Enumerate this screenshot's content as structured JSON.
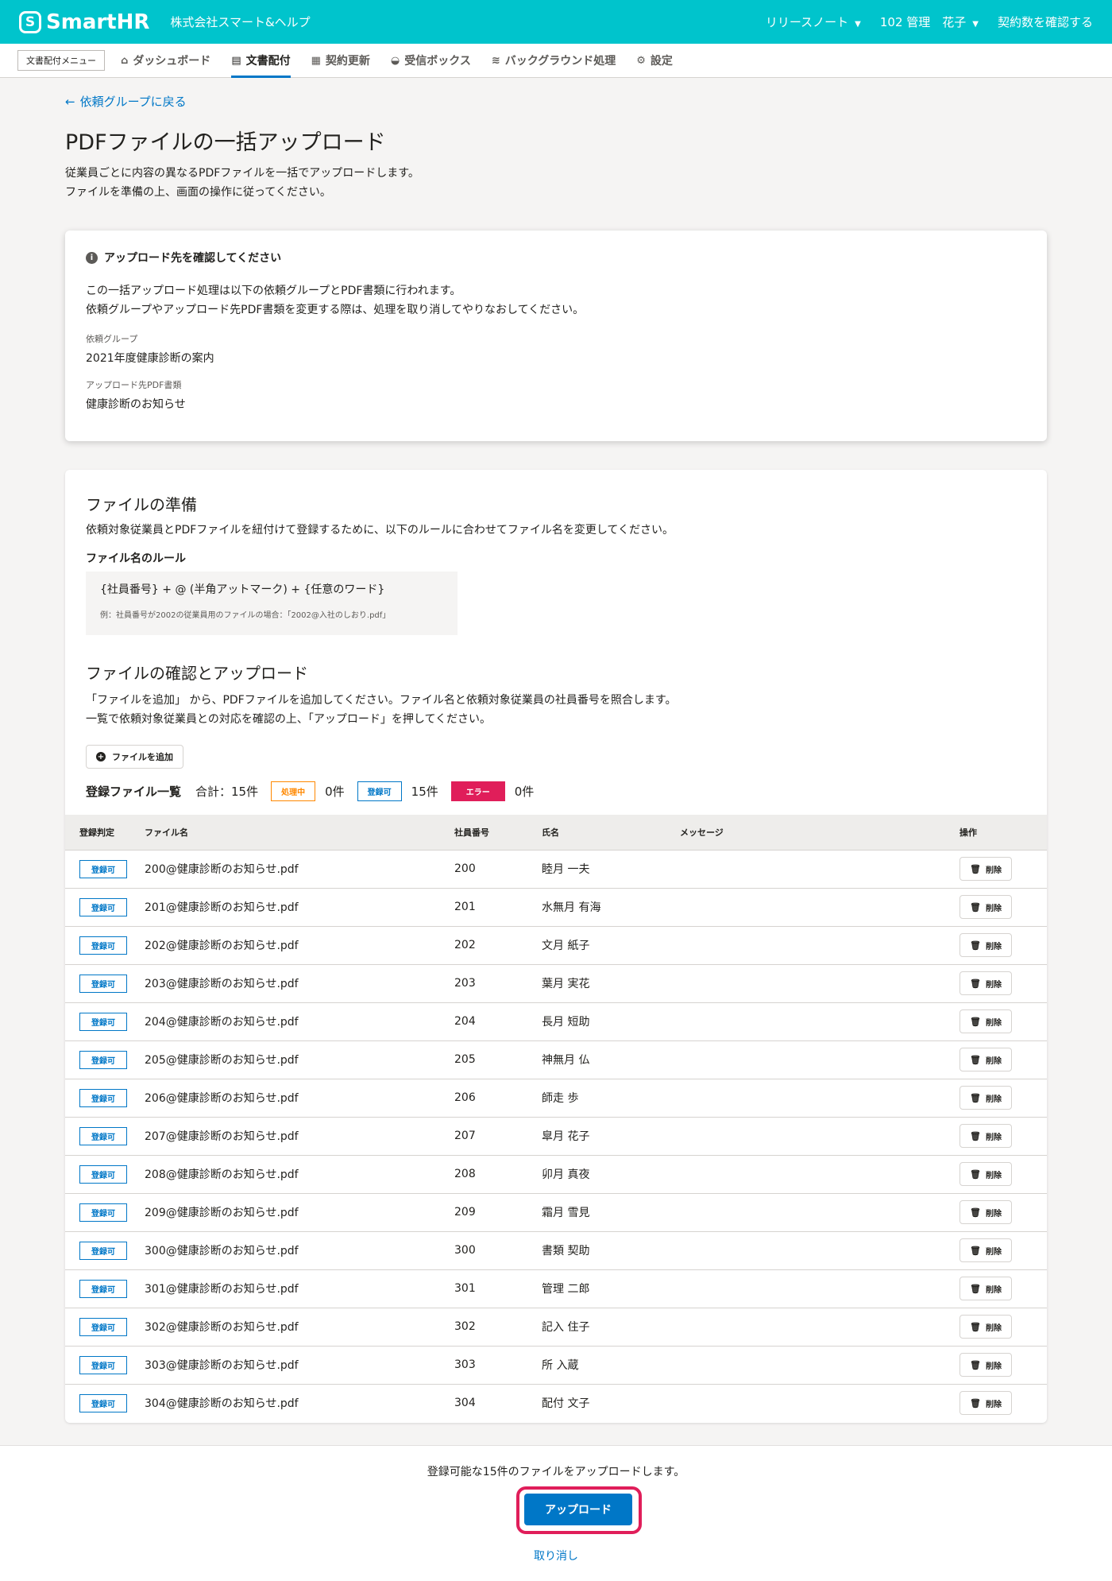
{
  "header": {
    "logo_mark": "S",
    "logo_text": "SmartHR",
    "company": "株式会社スマート&ヘルプ",
    "release_notes": "リリースノート",
    "user": "102 管理　花子",
    "contract_link": "契約数を確認する"
  },
  "nav": {
    "menu_chip": "文書配付メニュー",
    "items": [
      {
        "label": "ダッシュボード",
        "icon": "⌂"
      },
      {
        "label": "文書配付",
        "icon": "▤"
      },
      {
        "label": "契約更新",
        "icon": "▦"
      },
      {
        "label": "受信ボックス",
        "icon": "◒"
      },
      {
        "label": "バックグラウンド処理",
        "icon": "≋"
      },
      {
        "label": "設定",
        "icon": "⚙"
      }
    ]
  },
  "page": {
    "back_link": "依頼グループに戻る",
    "title": "PDFファイルの一括アップロード",
    "desc_line1": "従業員ごとに内容の異なるPDFファイルを一括でアップロードします。",
    "desc_line2": "ファイルを準備の上、画面の操作に従ってください。"
  },
  "info_card": {
    "title": "アップロード先を確認してください",
    "body_line1": "この一括アップロード処理は以下の依頼グループとPDF書類に行われます。",
    "body_line2": "依頼グループやアップロード先PDF書類を変更する際は、処理を取り消してやりなおしてください。",
    "group_label": "依頼グループ",
    "group_value": "2021年度健康診断の案内",
    "pdf_label": "アップロード先PDF書類",
    "pdf_value": "健康診断のお知らせ"
  },
  "prepare": {
    "title": "ファイルの準備",
    "text": "依頼対象従業員とPDFファイルを紐付けて登録するために、以下のルールに合わせてファイル名を変更してください。",
    "rule_heading": "ファイル名のルール",
    "rule_main": "{社員番号} + @ (半角アットマーク) + {任意のワード}",
    "rule_example": "例：社員番号が2002の従業員用のファイルの場合：「2002@入社のしおり.pdf」"
  },
  "confirm": {
    "title": "ファイルの確認とアップロード",
    "text_line1": "「ファイルを追加」 から、PDFファイルを追加してください。ファイル名と依頼対象従業員の社員番号を照合します。",
    "text_line2": "一覧で依頼対象従業員との対応を確認の上、「アップロード」を押してください。",
    "add_button": "ファイルを追加",
    "list_title": "登録ファイル一覧",
    "total": "合計：15件",
    "processing_label": "処理中",
    "processing_count": "0件",
    "ok_label": "登録可",
    "ok_count": "15件",
    "error_label": "エラー",
    "error_count": "0件"
  },
  "table": {
    "headers": [
      "登録判定",
      "ファイル名",
      "社員番号",
      "氏名",
      "メッセージ",
      "操作"
    ],
    "status_label": "登録可",
    "delete_label": "削除",
    "rows": [
      {
        "file": "200@健康診断のお知らせ.pdf",
        "id": "200",
        "name": "睦月 一夫"
      },
      {
        "file": "201@健康診断のお知らせ.pdf",
        "id": "201",
        "name": "水無月 有海"
      },
      {
        "file": "202@健康診断のお知らせ.pdf",
        "id": "202",
        "name": "文月 紙子"
      },
      {
        "file": "203@健康診断のお知らせ.pdf",
        "id": "203",
        "name": "葉月 実花"
      },
      {
        "file": "204@健康診断のお知らせ.pdf",
        "id": "204",
        "name": "長月 短助"
      },
      {
        "file": "205@健康診断のお知らせ.pdf",
        "id": "205",
        "name": "神無月 仏"
      },
      {
        "file": "206@健康診断のお知らせ.pdf",
        "id": "206",
        "name": "師走 歩"
      },
      {
        "file": "207@健康診断のお知らせ.pdf",
        "id": "207",
        "name": "皐月 花子"
      },
      {
        "file": "208@健康診断のお知らせ.pdf",
        "id": "208",
        "name": "卯月 真夜"
      },
      {
        "file": "209@健康診断のお知らせ.pdf",
        "id": "209",
        "name": "霜月 雪見"
      },
      {
        "file": "300@健康診断のお知らせ.pdf",
        "id": "300",
        "name": "書類 契助"
      },
      {
        "file": "301@健康診断のお知らせ.pdf",
        "id": "301",
        "name": "管理 二郎"
      },
      {
        "file": "302@健康診断のお知らせ.pdf",
        "id": "302",
        "name": "記入 住子"
      },
      {
        "file": "303@健康診断のお知らせ.pdf",
        "id": "303",
        "name": "所 入蔵"
      },
      {
        "file": "304@健康診断のお知らせ.pdf",
        "id": "304",
        "name": "配付 文子"
      }
    ]
  },
  "footer": {
    "message": "登録可能な15件のファイルをアップロードします。",
    "upload_button": "アップロード",
    "cancel_link": "取り消し"
  },
  "colors": {
    "brand": "#00c4cc",
    "primary": "#0077c7",
    "warning": "#ff8800",
    "danger": "#e01e5a"
  }
}
